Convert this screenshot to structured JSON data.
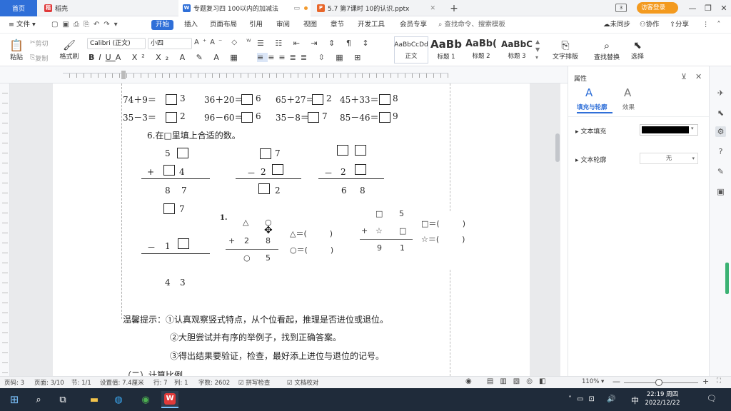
{
  "tabs": {
    "home": "首页",
    "tab1": "稻壳",
    "tab2": "专题复习四  100以内的加减法",
    "tab3": "5.7 第7课时  10的认识.pptx",
    "login_btn": "访客登录",
    "badge": "3"
  },
  "menu": {
    "file": "文件",
    "start": "开始",
    "insert": "插入",
    "layout": "页面布局",
    "ref": "引用",
    "review": "审阅",
    "view": "视图",
    "section": "章节",
    "dev": "开发工具",
    "vip": "会员专享",
    "search_placeholder": "查找命令、搜索模板",
    "sync": "未同步",
    "collab": "协作",
    "share": "分享"
  },
  "ribbon": {
    "paste": "粘贴",
    "cut": "剪切",
    "copy": "复制",
    "format_painter": "格式刷",
    "font": "Calibri (正文)",
    "size": "小四",
    "styles": [
      {
        "preview": "AaBbCcDd",
        "name": "正文"
      },
      {
        "preview": "AaBb",
        "name": "标题 1"
      },
      {
        "preview": "AaBb(",
        "name": "标题 2"
      },
      {
        "preview": "AaBbC",
        "name": "标题 3"
      }
    ],
    "text_layout": "文字排版",
    "find_replace": "查找替换",
    "select": "选择"
  },
  "doc": {
    "row1": [
      "74＋9＝",
      "3",
      "36＋20＝",
      "6",
      "65＋27＝",
      "2",
      "45＋33＝",
      "8"
    ],
    "row2": [
      "35－3＝",
      "2",
      "96－60＝",
      "6",
      "35－8＝",
      "7",
      "85－46＝",
      "9"
    ],
    "q6": "6.在□里填上合适的数。",
    "p1": {
      "top": "5",
      "op": "+",
      "mid": "4",
      "r1": "8",
      "r2": "7"
    },
    "p2": {
      "top": "7",
      "op": "－",
      "mid": "2",
      "r": "2"
    },
    "p3": {
      "op": "－",
      "mid": "2",
      "r1": "6",
      "r2": "8"
    },
    "p4": {
      "top": "7",
      "op": "－",
      "mid": "1",
      "r1": "4",
      "r2": "3"
    },
    "label1": "1.",
    "p5": {
      "t1": "△",
      "t2": "○",
      "op": "+",
      "m1": "2",
      "m2": "8",
      "b1": "○",
      "b2": "5",
      "a1": "△＝(",
      "a2": "○＝(",
      "close": ")"
    },
    "p6": {
      "t1": "□",
      "t2": "5",
      "op": "+",
      "m1": "☆",
      "m2": "□",
      "b1": "9",
      "b2": "1",
      "a1": "□＝(",
      "a2": "☆＝(",
      "close": ")"
    },
    "tip_title": "温馨提示：",
    "tip1": "①认真观察竖式特点，从个位看起，推理是否进位或退位。",
    "tip2": "②大胆尝试并有序的举例子，找到正确答案。",
    "tip3": "③得出结果要验证，检查，最好添上进位与退位的记号。",
    "partial": "（二）计算比例"
  },
  "panel": {
    "title": "属性",
    "tab_fill": "填充与轮廓",
    "tab_effect": "效果",
    "text_fill": "文本填充",
    "text_outline": "文本轮廓",
    "outline_value": "无",
    "fill_color": "#000000"
  },
  "status": {
    "page": "页码: 3",
    "pages": "页面: 3/10",
    "section": "节: 1/1",
    "setting": "设置值: 7.4厘米",
    "row": "行: 7",
    "col": "列: 1",
    "words": "字数: 2602",
    "spell": "拼写检查",
    "proof": "文档校对",
    "zoom": "110%"
  },
  "taskbar": {
    "time": "22:19 周四",
    "date": "2022/12/22",
    "ime": "中"
  }
}
